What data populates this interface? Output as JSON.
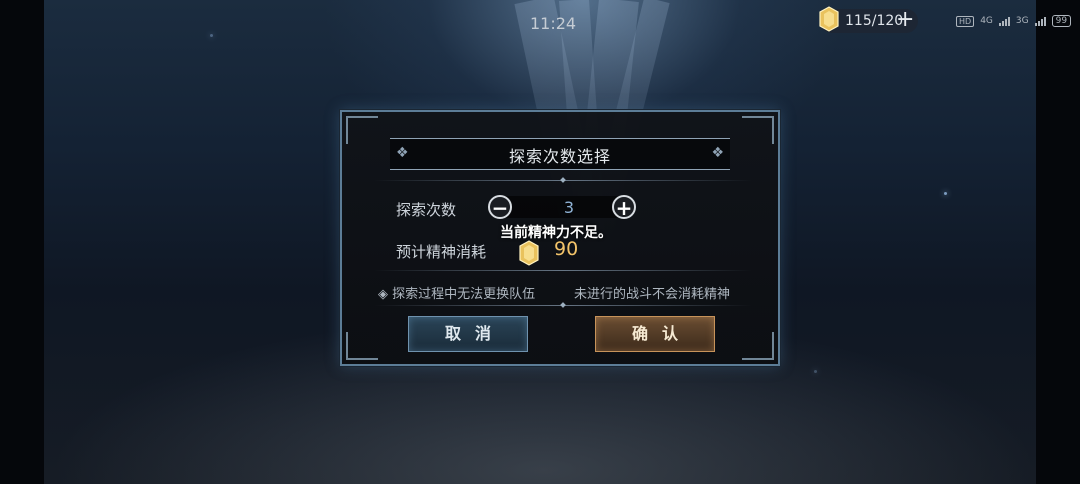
{
  "status_bar": {
    "time": "11:24",
    "stamina": "115/120",
    "plus": "+",
    "hd": "HD",
    "net_1": "4G",
    "net_2": "3G",
    "battery": "99"
  },
  "dialog": {
    "title": "探索次数选择",
    "count_label": "探索次数",
    "count_value": "3",
    "minus": "−",
    "plus": "+",
    "toast": "当前精神力不足。",
    "cost_label": "预计精神消耗",
    "cost_value": "90",
    "note_1": "◈ 探索过程中无法更换队伍",
    "note_2": "未进行的战斗不会消耗精神",
    "cancel_label": "取消",
    "confirm_label": "确认"
  },
  "colors": {
    "accent_gold": "#f3c46a",
    "frame_blue": "#5c7d97",
    "cancel_blue": "#2a4457",
    "confirm_brown": "#6a4d32"
  },
  "icons": [
    "stamina-gem-icon",
    "plus-icon",
    "minus-icon",
    "signal-icon",
    "battery-icon",
    "ornament-icon"
  ]
}
